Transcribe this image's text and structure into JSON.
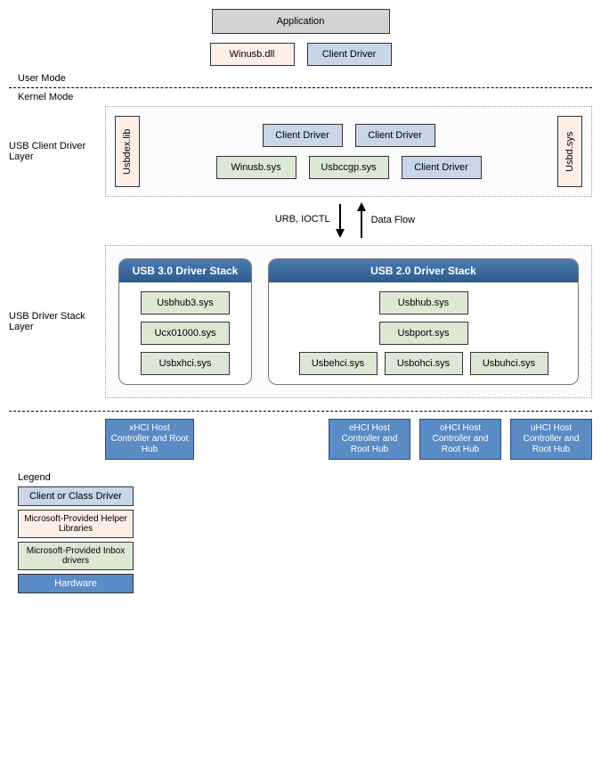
{
  "user_mode": {
    "label": "User Mode",
    "application": "Application",
    "winusb_dll": "Winusb.dll",
    "client_driver": "Client Driver"
  },
  "kernel_mode": {
    "label": "Kernel Mode",
    "client_layer": {
      "label": "USB Client Driver Layer",
      "usbdex": "Usbdex.lib",
      "client_driver_a": "Client Driver",
      "client_driver_b": "Client Driver",
      "winusb_sys": "Winusb.sys",
      "usbccgp": "Usbccgp.sys",
      "client_driver_c": "Client Driver",
      "usbd_sys": "Usbd.sys"
    },
    "arrows": {
      "down_label": "URB, IOCTL",
      "up_label": "Data Flow"
    },
    "stack_layer": {
      "label": "USB Driver Stack Layer",
      "usb30": {
        "title": "USB 3.0 Driver Stack",
        "usbhub3": "Usbhub3.sys",
        "ucx": "Ucx01000.sys",
        "usbxhci": "Usbxhci.sys"
      },
      "usb20": {
        "title": "USB 2.0 Driver Stack",
        "usbhub": "Usbhub.sys",
        "usbport": "Usbport.sys",
        "usbehci": "Usbehci.sys",
        "usbohci": "Usbohci.sys",
        "usbuhci": "Usbuhci.sys"
      }
    }
  },
  "hardware": {
    "xhci": "xHCI Host Controller and Root Hub",
    "ehci": "eHCI Host Controller and Root Hub",
    "ohci": "oHCI Host Controller and Root Hub",
    "uhci": "uHCI Host Controller and Root Hub"
  },
  "legend": {
    "title": "Legend",
    "client": "Client or Class Driver",
    "helper": "Microsoft-Provided Helper Libraries",
    "inbox": "Microsoft-Provided Inbox drivers",
    "hardware": "Hardware"
  }
}
